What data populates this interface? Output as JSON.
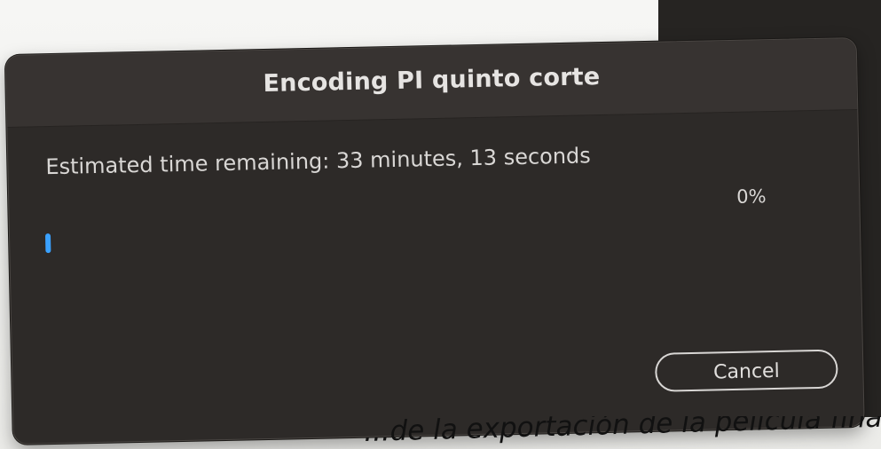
{
  "dialog": {
    "title": "Encoding PI quinto corte",
    "status_text": "Estimated time remaining: 33 minutes, 13 seconds",
    "progress_percent_label": "0%",
    "progress_value": 0.0,
    "cancel_label": "Cancel"
  },
  "page_caption": "...de la exportación de la película fina",
  "colors": {
    "dialog_bg": "#2d2a28",
    "titlebar_bg": "#373331",
    "text": "#e1dfdd",
    "accent": "#3aa1ff"
  }
}
